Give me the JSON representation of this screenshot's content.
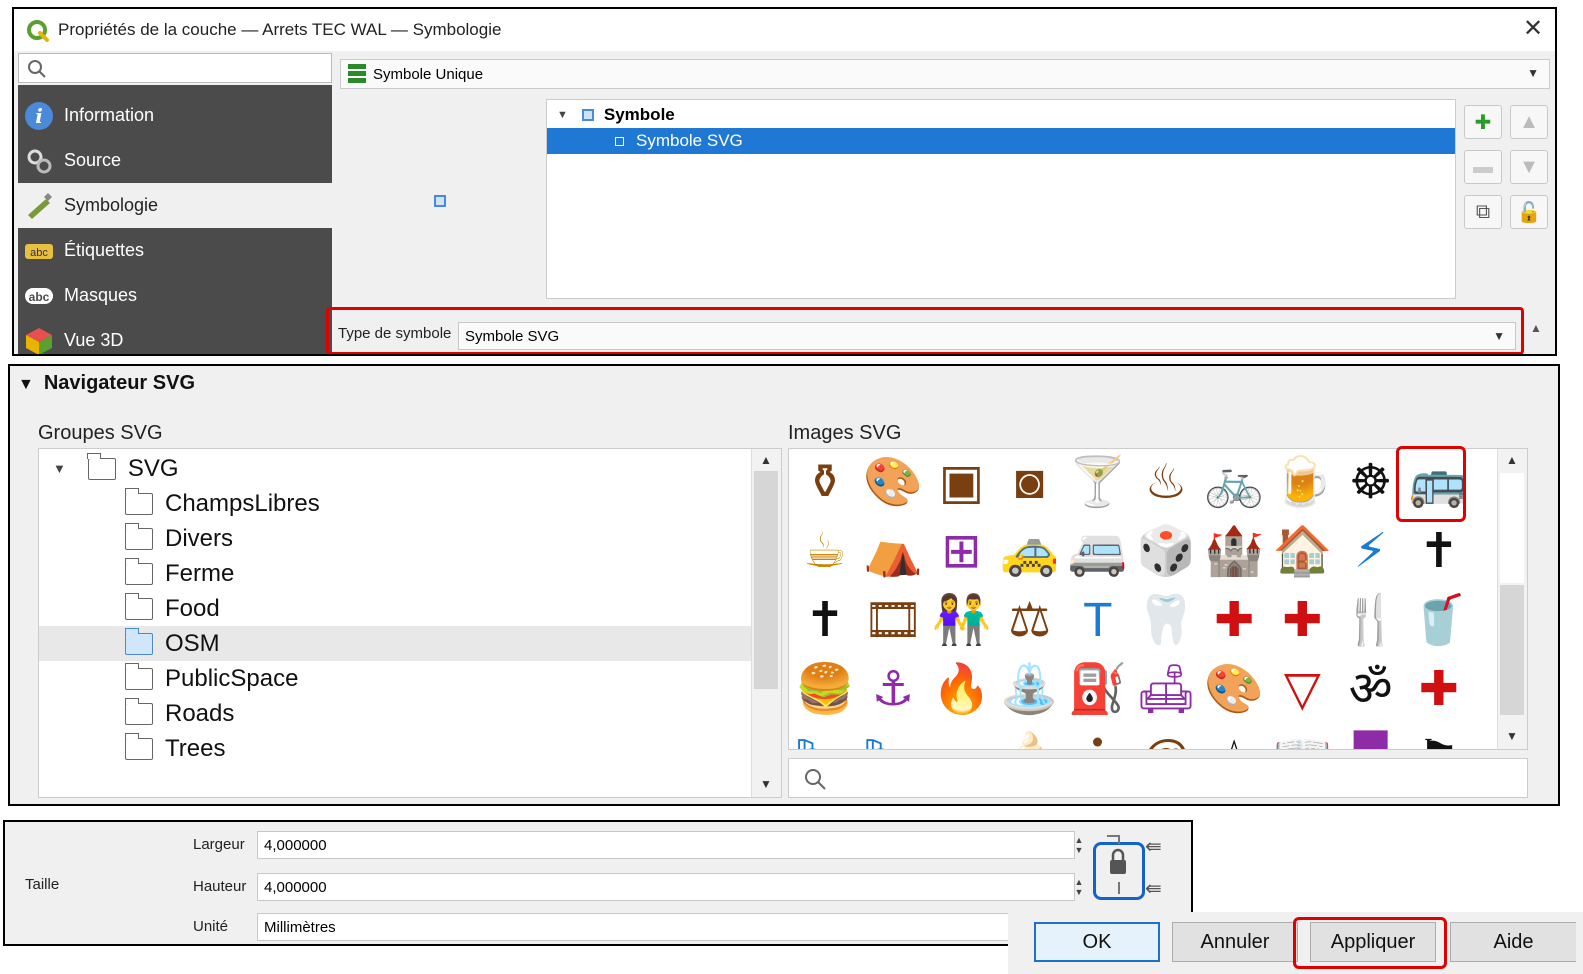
{
  "window": {
    "title": "Propriétés de la couche — Arrets TEC WAL — Symbologie",
    "close": "✕"
  },
  "sidebar": {
    "items": [
      {
        "label": "Information",
        "icon": "info-icon"
      },
      {
        "label": "Source",
        "icon": "source-icon"
      },
      {
        "label": "Symbologie",
        "icon": "symbology-icon",
        "active": true
      },
      {
        "label": "Étiquettes",
        "icon": "labels-icon"
      },
      {
        "label": "Masques",
        "icon": "masks-icon"
      },
      {
        "label": "Vue 3D",
        "icon": "3d-view-icon"
      }
    ]
  },
  "renderer": {
    "value": "Symbole Unique"
  },
  "symbol_tree": {
    "root": "Symbole",
    "child": "Symbole SVG"
  },
  "symbol_type": {
    "label": "Type de symbole",
    "value": "Symbole SVG"
  },
  "svg_browser": {
    "header": "Navigateur SVG",
    "groups_label": "Groupes SVG",
    "images_label": "Images SVG",
    "root_group": "SVG",
    "groups": [
      "ChampsLibres",
      "Divers",
      "Ferme",
      "Food",
      "OSM",
      "PublicSpace",
      "Roads",
      "Trees"
    ],
    "selected_group": "OSM",
    "icons": [
      [
        {
          "g": "⚱",
          "c": "#7a3f10"
        },
        {
          "g": "🎨",
          "c": "#7a3f10"
        },
        {
          "g": "▣",
          "c": "#7a3f10"
        },
        {
          "g": "◙",
          "c": "#7a3f10"
        },
        {
          "g": "🍸",
          "c": "#c8870a"
        },
        {
          "g": "♨",
          "c": "#7a3f10"
        },
        {
          "g": "🚲",
          "c": "#7a3f10"
        },
        {
          "g": "🍺",
          "c": "#c8870a"
        },
        {
          "g": "☸",
          "c": "#111111"
        },
        {
          "g": "🚌",
          "c": "#1a7ad4"
        }
      ],
      [
        {
          "g": "☕",
          "c": "#c8870a"
        },
        {
          "g": "⛺",
          "c": "#1a7ad4"
        },
        {
          "g": "⊞",
          "c": "#8e2ca8"
        },
        {
          "g": "🚕",
          "c": "#7a3f10"
        },
        {
          "g": "🚐",
          "c": "#1a7ad4"
        },
        {
          "g": "🎲",
          "c": "#7a3f10"
        },
        {
          "g": "🏰",
          "c": "#7a3f10"
        },
        {
          "g": "🏠",
          "c": "#1a7ad4"
        },
        {
          "g": "⚡",
          "c": "#1a7ad4"
        },
        {
          "g": "✝",
          "c": "#111111"
        }
      ],
      [
        {
          "g": "✝",
          "c": "#111111"
        },
        {
          "g": "🎞",
          "c": "#7a3f10"
        },
        {
          "g": "👫",
          "c": "#7a3f10"
        },
        {
          "g": "⚖",
          "c": "#7a3f10"
        },
        {
          "g": "T",
          "c": "#1a7ad4"
        },
        {
          "g": "🦷",
          "c": "#d01010"
        },
        {
          "g": "✚",
          "c": "#d01010"
        },
        {
          "g": "✚",
          "c": "#d01010"
        },
        {
          "g": "🍴",
          "c": "#8e2ca8"
        },
        {
          "g": "🥤",
          "c": "#c8870a"
        }
      ],
      [
        {
          "g": "🍔",
          "c": "#c8870a"
        },
        {
          "g": "⚓",
          "c": "#8e2ca8"
        },
        {
          "g": "🔥",
          "c": "#7a3f10"
        },
        {
          "g": "⛲",
          "c": "#1a7ad4"
        },
        {
          "g": "⛽",
          "c": "#1a7ad4"
        },
        {
          "g": "🛋",
          "c": "#8e2ca8"
        },
        {
          "g": "🎨",
          "c": "#7a3f10"
        },
        {
          "g": "▽",
          "c": "#d01010"
        },
        {
          "g": "ॐ",
          "c": "#111111"
        },
        {
          "g": "✚",
          "c": "#d01010"
        }
      ],
      [
        {
          "g": "🛏",
          "c": "#1a7ad4"
        },
        {
          "g": "🛏",
          "c": "#1a7ad4"
        },
        {
          "g": "▬",
          "c": "#444444"
        },
        {
          "g": "🍦",
          "c": "#c8870a"
        },
        {
          "g": "ℹ",
          "c": "#7a3f10"
        },
        {
          "g": "@",
          "c": "#7a3f10"
        },
        {
          "g": "☆",
          "c": "#111111"
        },
        {
          "g": "📖",
          "c": "#7a3f10"
        },
        {
          "g": "▀",
          "c": "#8e2ca8"
        },
        {
          "g": "⚑",
          "c": "#111111"
        }
      ]
    ]
  },
  "size": {
    "group_label": "Taille",
    "width_label": "Largeur",
    "width_value": "4,000000",
    "height_label": "Hauteur",
    "height_value": "4,000000",
    "unit_label": "Unité",
    "unit_value": "Millimètres"
  },
  "buttons": {
    "ok": "OK",
    "cancel": "Annuler",
    "apply": "Appliquer",
    "help": "Aide"
  },
  "colors": {
    "highlight_red": "#e00000",
    "selection_blue": "#1e78d4",
    "lock_blue": "#1464c8",
    "sidebar_dark": "#4b4b4b"
  }
}
